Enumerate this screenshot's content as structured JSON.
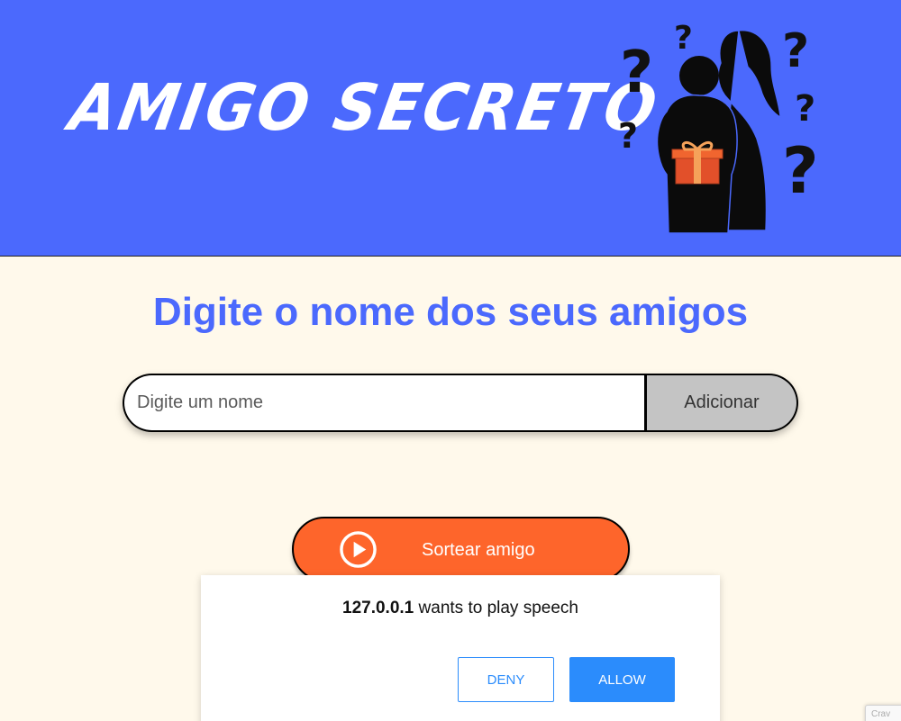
{
  "header": {
    "logo_text": "AMIGO SECRETO",
    "background_color": "#4b69fd",
    "illustration_icon": "couple-with-gift-and-question-marks-icon"
  },
  "main": {
    "title": "Digite o nome dos seus amigos",
    "name_input": {
      "placeholder": "Digite um nome",
      "value": ""
    },
    "add_button_label": "Adicionar",
    "draw_button_label": "Sortear amigo",
    "draw_button_icon": "play-circle-icon",
    "accent_color": "#fe652b"
  },
  "permission_dialog": {
    "origin": "127.0.0.1",
    "message": " wants to play speech",
    "deny_label": "DENY",
    "allow_label": "ALLOW",
    "button_color": "#2b8cfc"
  },
  "recaptcha": {
    "text": "Crav"
  }
}
